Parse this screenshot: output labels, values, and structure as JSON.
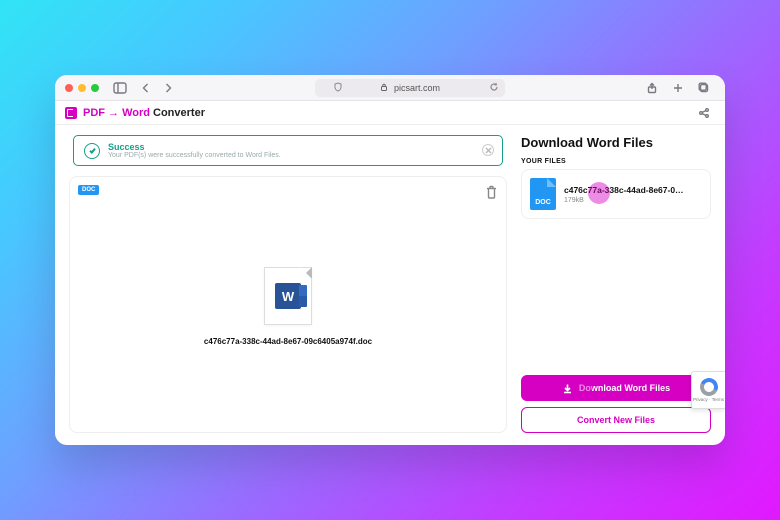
{
  "browser": {
    "url_label": "picsart.com"
  },
  "header": {
    "title_prefix": "PDF → Word",
    "title_suffix": "Converter"
  },
  "banner": {
    "title": "Success",
    "subtitle": "Your PDF(s) were successfully converted to Word Files."
  },
  "file": {
    "chip": "DOC",
    "word_letter": "W",
    "name": "c476c77a-338c-44ad-8e67-09c6405a974f.doc"
  },
  "sidebar": {
    "title": "Download Word Files",
    "your_files": "YOUR FILES",
    "doc_label": "DOC",
    "file_name": "c476c77a-338c-44ad-8e67-0…",
    "file_size": "179kB",
    "download_label": "Download Word Files",
    "convert_label": "Convert New Files"
  },
  "recaptcha": {
    "text": "Privacy · Terms"
  }
}
